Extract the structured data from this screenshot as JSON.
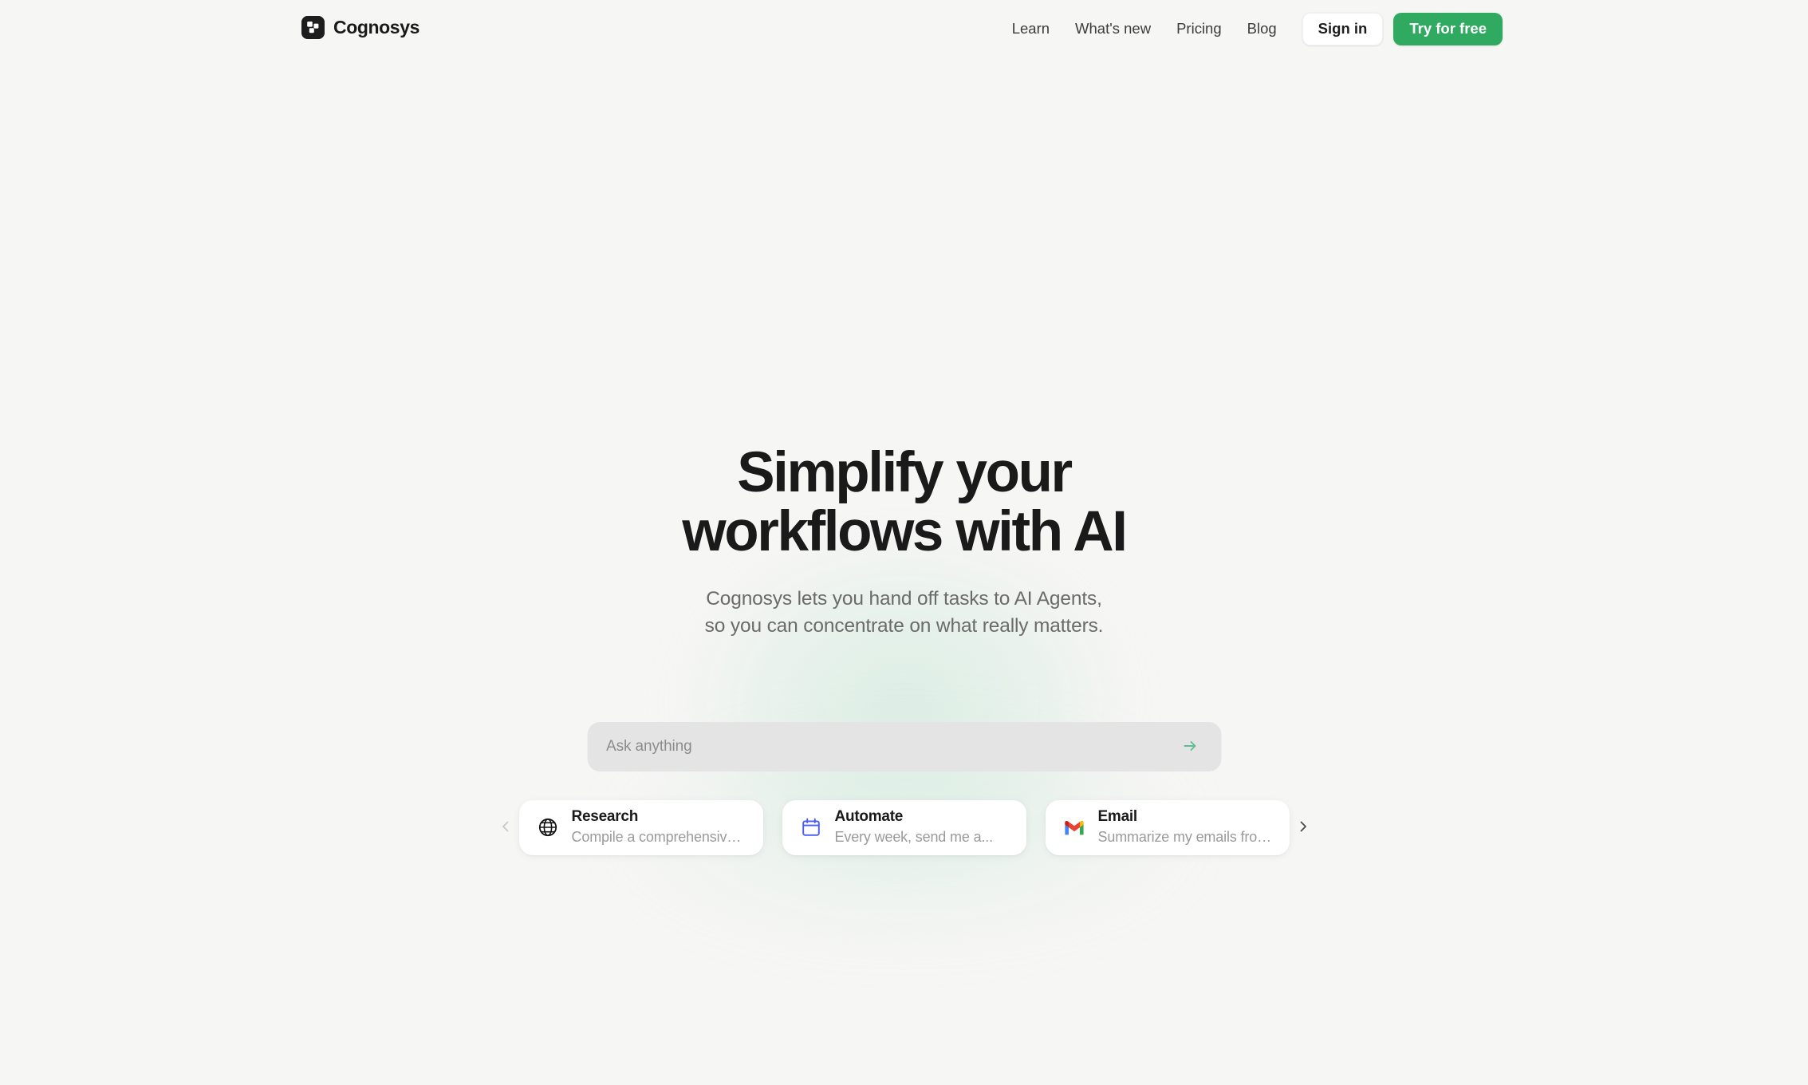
{
  "brand": {
    "name": "Cognosys",
    "logo_icon": "cognosys-logo-icon"
  },
  "nav": {
    "links": [
      {
        "label": "Learn"
      },
      {
        "label": "What's new"
      },
      {
        "label": "Pricing"
      },
      {
        "label": "Blog"
      }
    ],
    "sign_in_label": "Sign in",
    "try_label": "Try for free"
  },
  "hero": {
    "headline_line1": "Simplify your",
    "headline_line2": "workflows with AI",
    "subtitle_line1": "Cognosys lets you hand off tasks to AI Agents,",
    "subtitle_line2": "so you can concentrate on what really matters."
  },
  "search": {
    "placeholder": "Ask anything",
    "value": "",
    "send_icon": "arrow-right-icon"
  },
  "carousel": {
    "prev_icon": "chevron-left-icon",
    "next_icon": "chevron-right-icon",
    "cards": [
      {
        "icon": "globe-icon",
        "title": "Research",
        "subtitle": "Compile a comprehensive..."
      },
      {
        "icon": "calendar-icon",
        "title": "Automate",
        "subtitle": "Every week, send me a..."
      },
      {
        "icon": "gmail-icon",
        "title": "Email",
        "subtitle": "Summarize my emails from..."
      }
    ]
  },
  "colors": {
    "page_background": "#f6f6f5",
    "accent_green": "#2faa60",
    "send_arrow_green": "#5fbd93",
    "text_primary": "#1a1a1a",
    "text_muted": "#6b6b6b",
    "card_subtitle": "#9a9a9a",
    "search_field": "#e4e4e4",
    "calendar_blue": "#4a5cf0"
  }
}
